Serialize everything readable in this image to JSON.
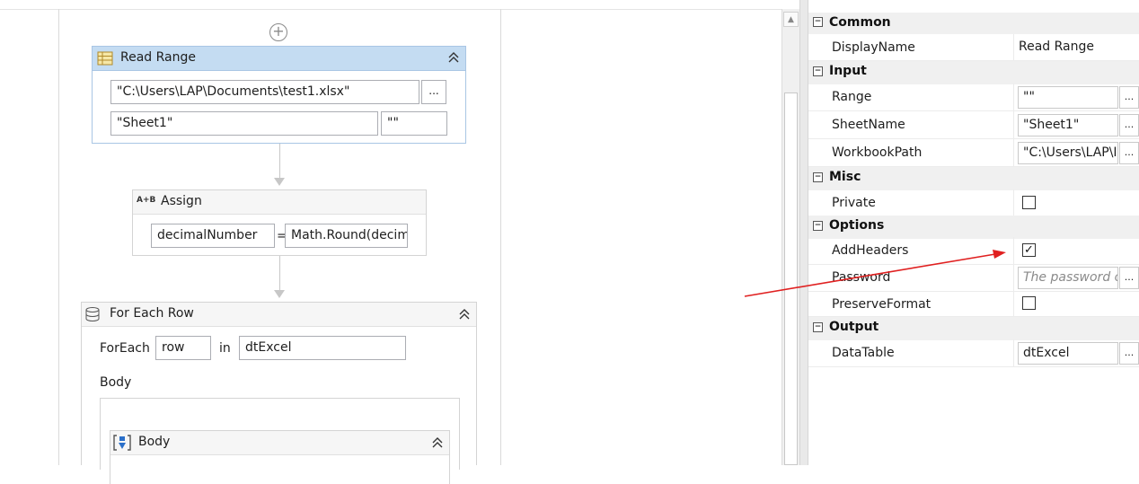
{
  "designer": {
    "read_range": {
      "title": "Read Range",
      "workbook_path": "\"C:\\Users\\LAP\\Documents\\test1.xlsx\"",
      "sheet_name": "\"Sheet1\"",
      "range": "\"\"",
      "ellipsis": "..."
    },
    "assign": {
      "title": "Assign",
      "icon_text": "A+B",
      "to": "decimalNumber",
      "equals": "=",
      "value": "Math.Round(decim"
    },
    "for_each_row": {
      "title": "For Each Row",
      "foreach_label": "ForEach",
      "item": "row",
      "in_label": "in",
      "collection": "dtExcel",
      "body_label": "Body",
      "inner_body_title": "Body"
    }
  },
  "properties": {
    "categories": [
      {
        "name": "Common",
        "rows": [
          {
            "name": "DisplayName",
            "value": "Read Range",
            "kind": "text"
          }
        ]
      },
      {
        "name": "Input",
        "rows": [
          {
            "name": "Range",
            "value": "\"\"",
            "kind": "field"
          },
          {
            "name": "SheetName",
            "value": "\"Sheet1\"",
            "kind": "field"
          },
          {
            "name": "WorkbookPath",
            "value": "\"C:\\Users\\LAP\\I",
            "kind": "field"
          }
        ]
      },
      {
        "name": "Misc",
        "rows": [
          {
            "name": "Private",
            "checked": false,
            "kind": "checkbox"
          }
        ]
      },
      {
        "name": "Options",
        "rows": [
          {
            "name": "AddHeaders",
            "checked": true,
            "kind": "checkbox"
          },
          {
            "name": "Password",
            "placeholder": "The password o",
            "kind": "field"
          },
          {
            "name": "PreserveFormat",
            "checked": false,
            "kind": "checkbox"
          }
        ]
      },
      {
        "name": "Output",
        "rows": [
          {
            "name": "DataTable",
            "value": "dtExcel",
            "kind": "field"
          }
        ]
      }
    ],
    "toggle_symbol": "−",
    "ellipsis": "...",
    "check_mark": "✓"
  },
  "colors": {
    "annotation_arrow": "#e02020",
    "header_blue": "#c4dcf2"
  }
}
